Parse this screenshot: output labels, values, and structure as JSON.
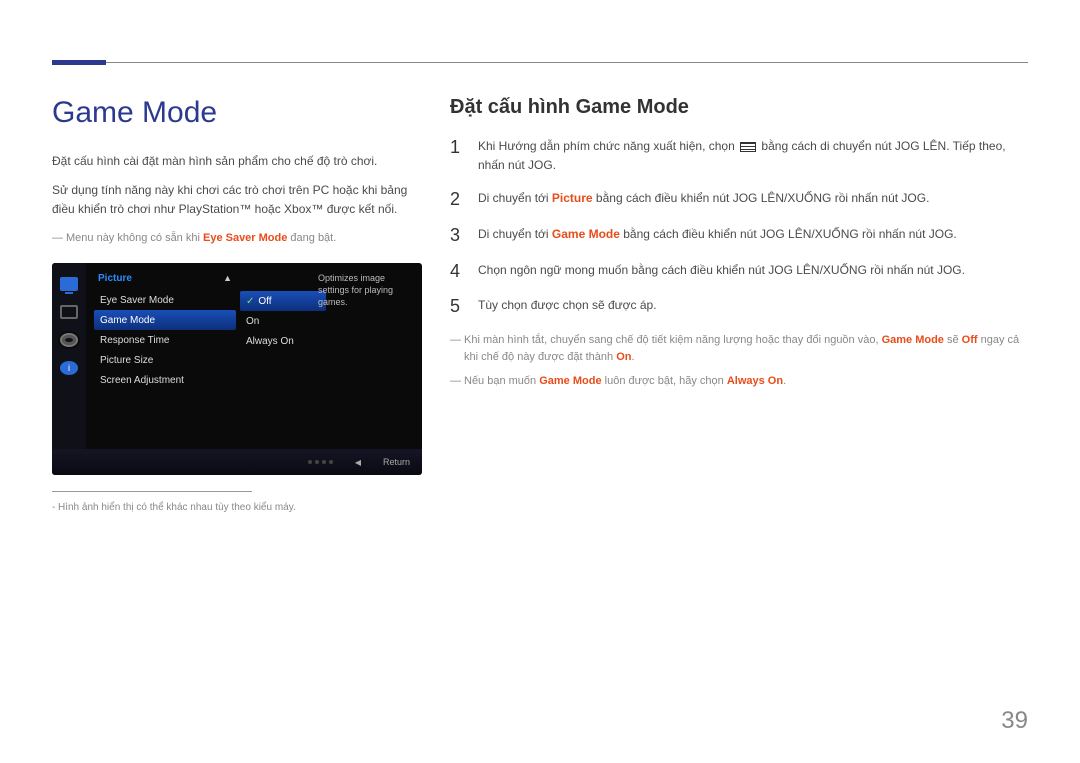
{
  "page_number": "39",
  "left": {
    "title": "Game Mode",
    "para1": "Đặt cấu hình cài đặt màn hình sản phẩm cho chế độ trò chơi.",
    "para2": "Sử dụng tính năng này khi chơi các trò chơi trên PC hoặc khi bảng điều khiển trò chơi như PlayStation™ hoặc Xbox™ được kết nối.",
    "note1_pre": "Menu này không có sẵn khi ",
    "note1_hl": "Eye Saver Mode",
    "note1_post": " đang bật.",
    "caption": "Hình ảnh hiển thị có thể khác nhau tùy theo kiểu máy."
  },
  "osd": {
    "heading": "Picture",
    "items": [
      "Eye Saver Mode",
      "Game Mode",
      "Response Time",
      "Picture Size",
      "Screen Adjustment"
    ],
    "options": [
      "Off",
      "On",
      "Always On"
    ],
    "desc": "Optimizes image settings for playing games.",
    "return": "Return"
  },
  "right": {
    "subtitle": "Đặt cấu hình Game Mode",
    "steps": [
      {
        "n": "1",
        "pre": "Khi Hướng dẫn phím chức năng xuất hiện, chọn ",
        "post": " bằng cách di chuyển nút JOG LÊN. Tiếp theo, nhấn nút JOG."
      },
      {
        "n": "2",
        "pre": "Di chuyển tới ",
        "hl": "Picture",
        "post": " bằng cách điều khiển nút JOG LÊN/XUỐNG rồi nhấn nút JOG."
      },
      {
        "n": "3",
        "pre": "Di chuyển tới ",
        "hl": "Game Mode",
        "post": " bằng cách điều khiển nút JOG LÊN/XUỐNG rồi nhấn nút JOG."
      },
      {
        "n": "4",
        "text": "Chọn ngôn ngữ mong muốn bằng cách điều khiển nút JOG LÊN/XUỐNG rồi nhấn nút JOG."
      },
      {
        "n": "5",
        "text": "Tùy chọn được chọn sẽ được áp."
      }
    ],
    "foot1": {
      "pre": "Khi màn hình tắt, chuyển sang chế độ tiết kiệm năng lượng hoặc thay đổi nguồn vào, ",
      "h1": "Game Mode",
      "mid": " sẽ ",
      "h2": "Off",
      "post": " ngay cả khi chế độ này được đặt thành ",
      "h3": "On",
      "end": "."
    },
    "foot2": {
      "pre": "Nếu bạn muốn ",
      "h1": "Game Mode",
      "mid": " luôn được bật, hãy chọn ",
      "h2": "Always On",
      "end": "."
    }
  }
}
